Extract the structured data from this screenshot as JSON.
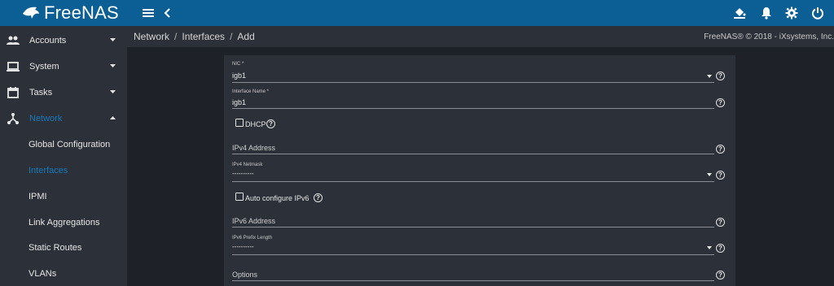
{
  "topbar": {
    "logo_text": "FreeNAS",
    "icons": [
      "menu-icon",
      "chevron-left-icon",
      "theme-bucket-icon",
      "bell-icon",
      "gear-icon",
      "power-icon"
    ],
    "color": "#0c5f95"
  },
  "sidebar": {
    "items": [
      {
        "label": "Accounts",
        "icon": "people-icon"
      },
      {
        "label": "System",
        "icon": "laptop-icon"
      },
      {
        "label": "Tasks",
        "icon": "calendar-icon"
      },
      {
        "label": "Network",
        "icon": "network-icon"
      }
    ],
    "subitems": [
      {
        "label": "Global Configuration"
      },
      {
        "label": "Interfaces"
      },
      {
        "label": "IPMI"
      },
      {
        "label": "Link Aggregations"
      },
      {
        "label": "Static Routes"
      },
      {
        "label": "VLANs"
      }
    ],
    "active_item": "Network",
    "active_subitem": "Interfaces",
    "accent_color": "#1779ba"
  },
  "breadcrumb": {
    "parts": [
      "Network",
      "Interfaces",
      "Add"
    ],
    "separator": "/"
  },
  "copyright": "FreeNAS® © 2018 - iXsystems, Inc.",
  "form": {
    "nic": {
      "label": "NIC *",
      "value": "igb1"
    },
    "interface_name": {
      "label": "Interface Name *",
      "value": "igb1"
    },
    "dhcp": {
      "label": "DHCP",
      "checked": false
    },
    "ipv4_address": {
      "placeholder": "IPv4 Address",
      "value": ""
    },
    "ipv4_netmask": {
      "label": "IPv4 Netmask",
      "value": "----------"
    },
    "auto_ipv6": {
      "label": "Auto configure IPv6",
      "checked": false
    },
    "ipv6_address": {
      "placeholder": "IPv6 Address",
      "value": ""
    },
    "ipv6_prefix": {
      "label": "IPv6 Prefix Length",
      "value": "----------"
    },
    "options": {
      "placeholder": "Options",
      "value": ""
    },
    "help_glyph": "?"
  }
}
